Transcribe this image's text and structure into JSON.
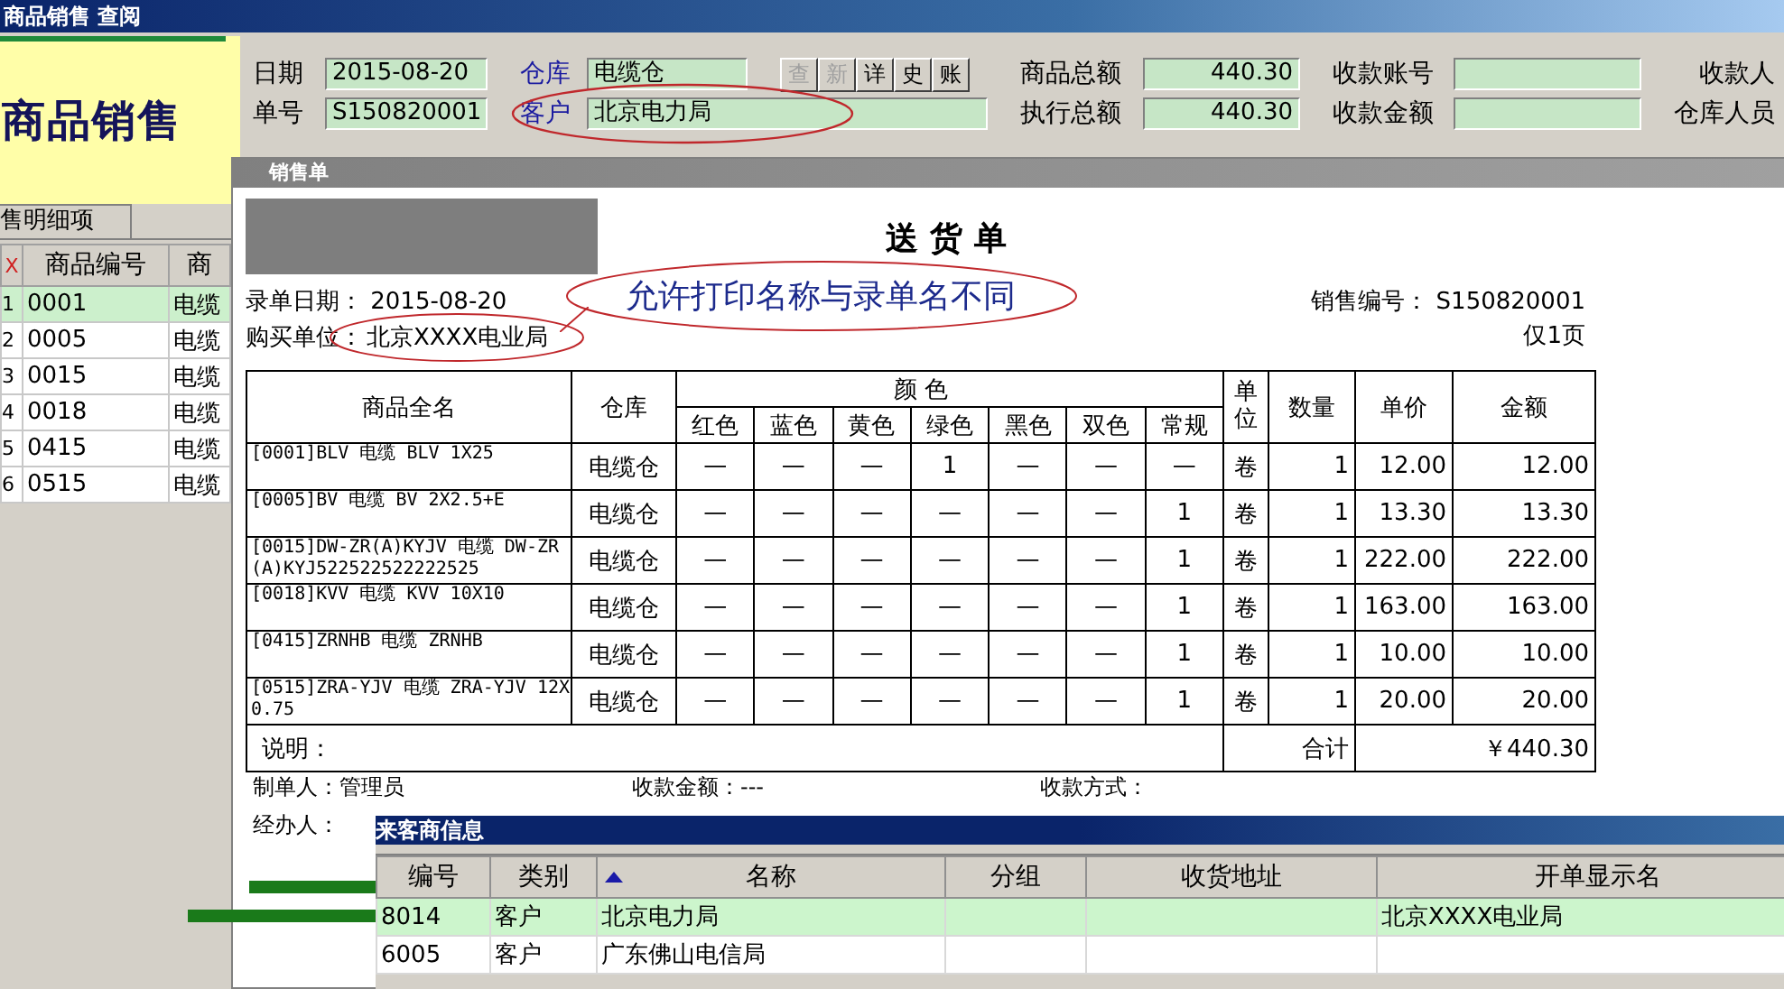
{
  "window": {
    "title": "商品销售 查阅"
  },
  "logo": "商品销售",
  "header_rows": [
    [
      {
        "kind": "field",
        "label": "日期",
        "value": "2015-08-20"
      },
      {
        "kind": "field",
        "label": "仓库",
        "value": "电缆仓",
        "link": true
      },
      {
        "kind": "buttons",
        "buttons": [
          {
            "label": "查",
            "disabled": true
          },
          {
            "label": "新",
            "disabled": true
          },
          {
            "label": "详",
            "disabled": false
          },
          {
            "label": "史",
            "disabled": false
          },
          {
            "label": "账",
            "disabled": false
          }
        ]
      },
      {
        "kind": "field",
        "label": "商品总额",
        "value": "440.30",
        "numeric": true
      },
      {
        "kind": "field",
        "label": "收款账号"
      },
      {
        "kind": "label",
        "label": "收款人"
      }
    ],
    [
      {
        "kind": "field",
        "label": "单号",
        "value": "S150820001"
      },
      {
        "kind": "field",
        "label": "客户",
        "value": "北京电力局",
        "link": true,
        "wide": true,
        "annotated": true
      },
      {
        "kind": "field",
        "label": "执行总额",
        "value": "440.30",
        "numeric": true
      },
      {
        "kind": "field",
        "label": "收款金额"
      },
      {
        "kind": "label",
        "label": "仓库人员"
      }
    ]
  ],
  "detail_tab": "售明细项",
  "detail_grid": {
    "columns": [
      "X",
      "商品编号",
      "商"
    ],
    "rows": [
      {
        "cells": [
          "1",
          "0001",
          "电缆"
        ],
        "selected": true
      },
      {
        "cells": [
          "2",
          "0005",
          "电缆"
        ],
        "selected": false
      },
      {
        "cells": [
          "3",
          "0015",
          "电缆"
        ],
        "selected": false
      },
      {
        "cells": [
          "4",
          "0018",
          "电缆"
        ],
        "selected": false
      },
      {
        "cells": [
          "5",
          "0415",
          "电缆"
        ],
        "selected": false
      },
      {
        "cells": [
          "6",
          "0515",
          "电缆"
        ],
        "selected": false
      }
    ]
  },
  "document": {
    "window_title": "销售单",
    "title": "送 货 单",
    "date_label": "录单日期：",
    "date": "2015-08-20",
    "note": "允许打印名称与录单名不同",
    "sale_no_label": "销售编号：",
    "sale_no": "S150820001",
    "buyer_label": "购买单位：",
    "buyer": "北京XXXX电业局",
    "pages": "仅1页",
    "columns": {
      "name": "商品全名",
      "warehouse": "仓库",
      "color_group": "颜 色",
      "colors": [
        "红色",
        "蓝色",
        "黄色",
        "绿色",
        "黑色",
        "双色",
        "常规"
      ],
      "unit": "单位",
      "qty": "数量",
      "price": "单价",
      "amount": "金额"
    },
    "rows": [
      {
        "name": "[0001]BLV 电缆 BLV 1X25",
        "warehouse": "电缆仓",
        "colors": [
          "—",
          "—",
          "—",
          "1",
          "—",
          "—",
          "—"
        ],
        "unit": "卷",
        "qty": "1",
        "price": "12.00",
        "amount": "12.00"
      },
      {
        "name": "[0005]BV 电缆 BV 2X2.5+E",
        "warehouse": "电缆仓",
        "colors": [
          "—",
          "—",
          "—",
          "—",
          "—",
          "—",
          "1"
        ],
        "unit": "卷",
        "qty": "1",
        "price": "13.30",
        "amount": "13.30"
      },
      {
        "name": "[0015]DW-ZR(A)KYJV 电缆 DW-ZR(A)KYJ522522522222525",
        "warehouse": "电缆仓",
        "colors": [
          "—",
          "—",
          "—",
          "—",
          "—",
          "—",
          "1"
        ],
        "unit": "卷",
        "qty": "1",
        "price": "222.00",
        "amount": "222.00"
      },
      {
        "name": "[0018]KVV 电缆 KVV 10X10",
        "warehouse": "电缆仓",
        "colors": [
          "—",
          "—",
          "—",
          "—",
          "—",
          "—",
          "1"
        ],
        "unit": "卷",
        "qty": "1",
        "price": "163.00",
        "amount": "163.00"
      },
      {
        "name": "[0415]ZRNHB 电缆 ZRNHB",
        "warehouse": "电缆仓",
        "colors": [
          "—",
          "—",
          "—",
          "—",
          "—",
          "—",
          "1"
        ],
        "unit": "卷",
        "qty": "1",
        "price": "10.00",
        "amount": "10.00"
      },
      {
        "name": "[0515]ZRA-YJV 电缆 ZRA-YJV 12X0.75",
        "warehouse": "电缆仓",
        "colors": [
          "—",
          "—",
          "—",
          "—",
          "—",
          "—",
          "1"
        ],
        "unit": "卷",
        "qty": "1",
        "price": "20.00",
        "amount": "20.00"
      }
    ],
    "remark_label": "说明：",
    "total_label": "合计",
    "total": "￥440.30",
    "footer": [
      {
        "label": "制单人：",
        "value": "管理员"
      },
      {
        "label": "收款金额：",
        "value": "---"
      },
      {
        "label": "收款方式："
      }
    ],
    "handler_label": "经办人："
  },
  "partner_popup": {
    "title": "来客商信息",
    "columns": [
      {
        "label": "编号",
        "sorted": false
      },
      {
        "label": "类别",
        "sorted": false
      },
      {
        "label": "名称",
        "sorted": true
      },
      {
        "label": "分组",
        "sorted": false
      },
      {
        "label": "收货地址",
        "sorted": false
      },
      {
        "label": "开单显示名",
        "sorted": false
      }
    ],
    "rows": [
      {
        "code": "8014",
        "type": "客户",
        "name": "北京电力局",
        "display_name": "北京XXXX电业局",
        "selected": true
      },
      {
        "code": "6005",
        "type": "客户",
        "name": "广东佛山电信局",
        "selected": false
      }
    ]
  }
}
